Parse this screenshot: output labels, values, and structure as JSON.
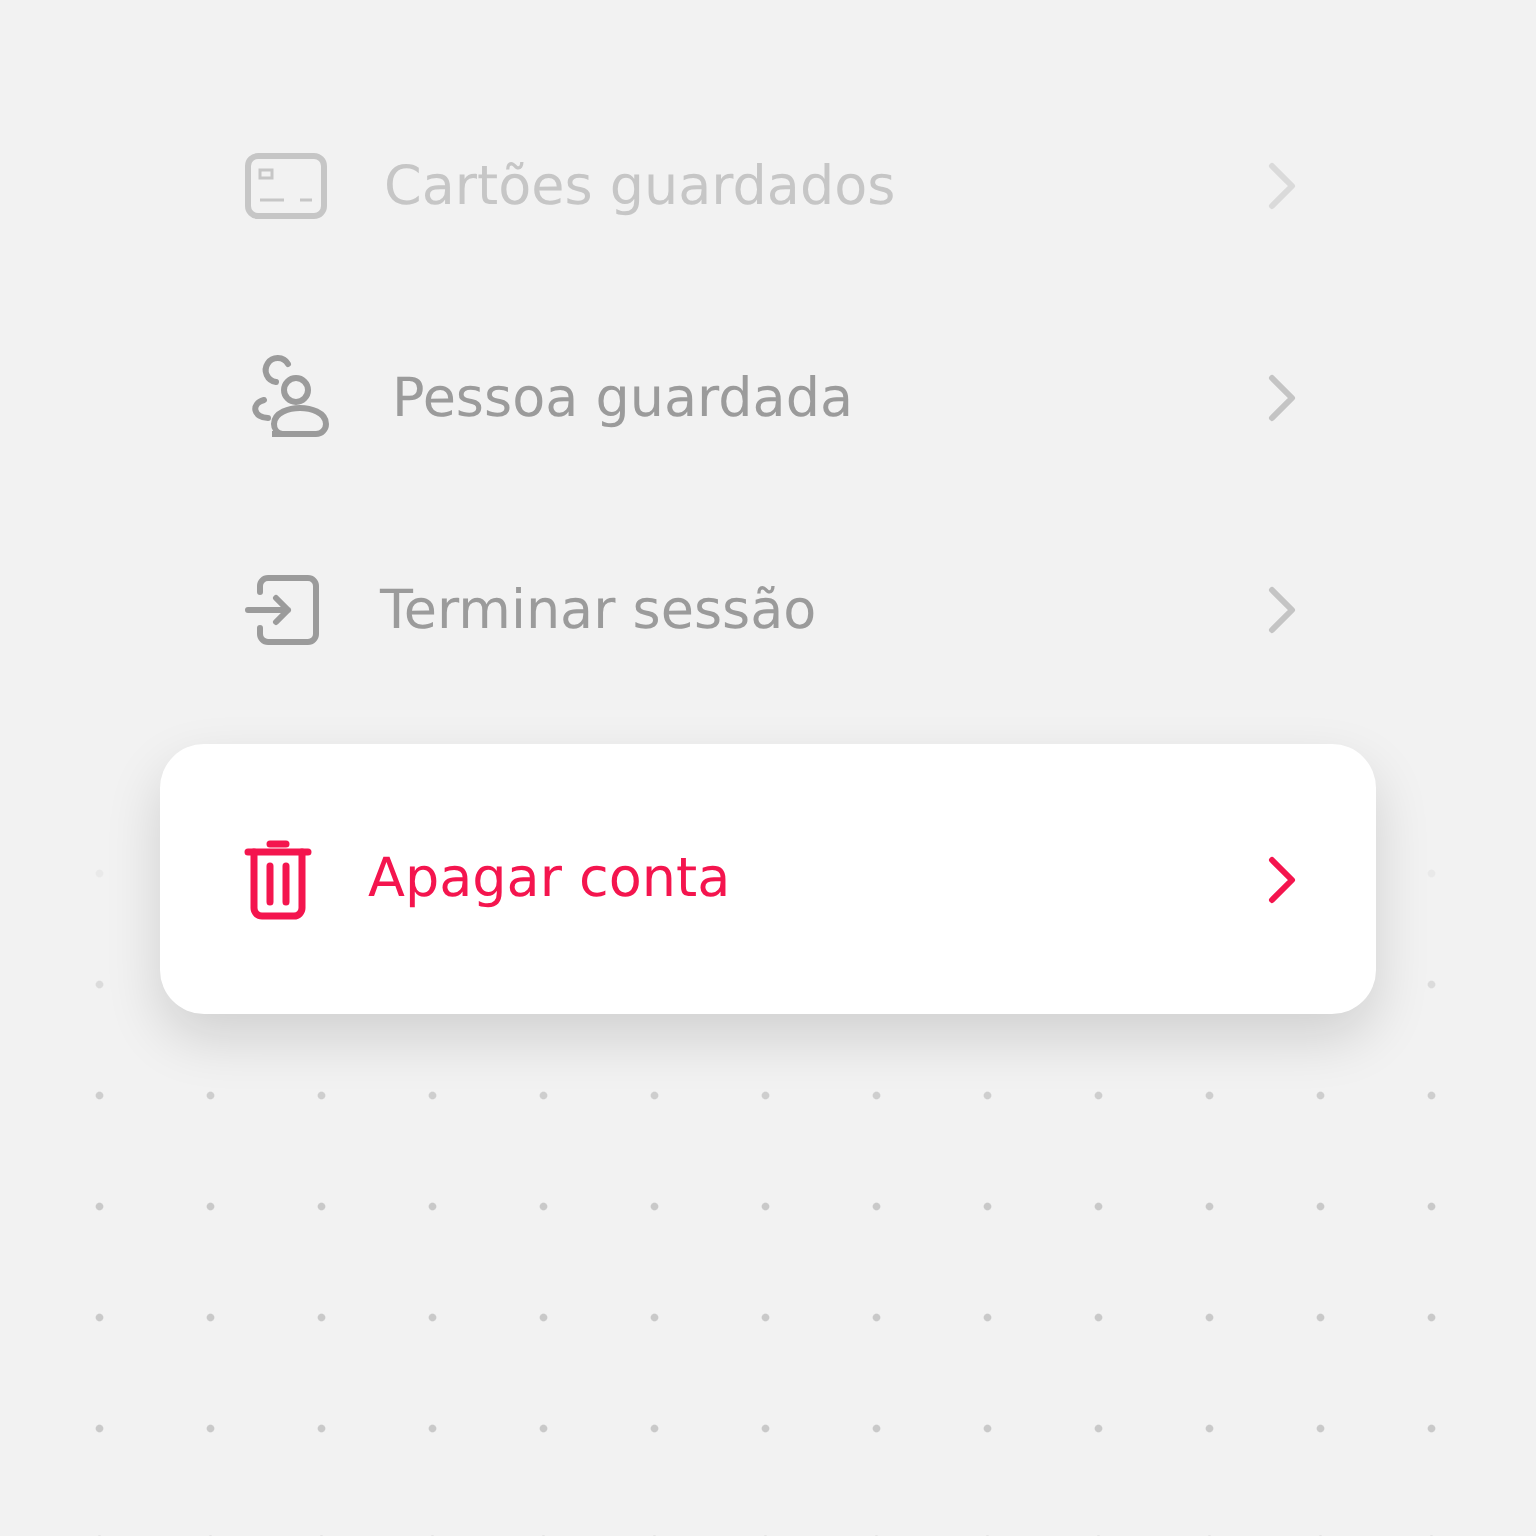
{
  "menu_items": [
    {
      "label": "Cartões guardados",
      "disabled": true,
      "selected": false
    },
    {
      "label": "Pessoa guardada",
      "disabled": false,
      "selected": false
    },
    {
      "label": "Terminar sessão",
      "disabled": false,
      "selected": false
    },
    {
      "label": "Apagar conta",
      "disabled": false,
      "selected": true
    }
  ]
}
